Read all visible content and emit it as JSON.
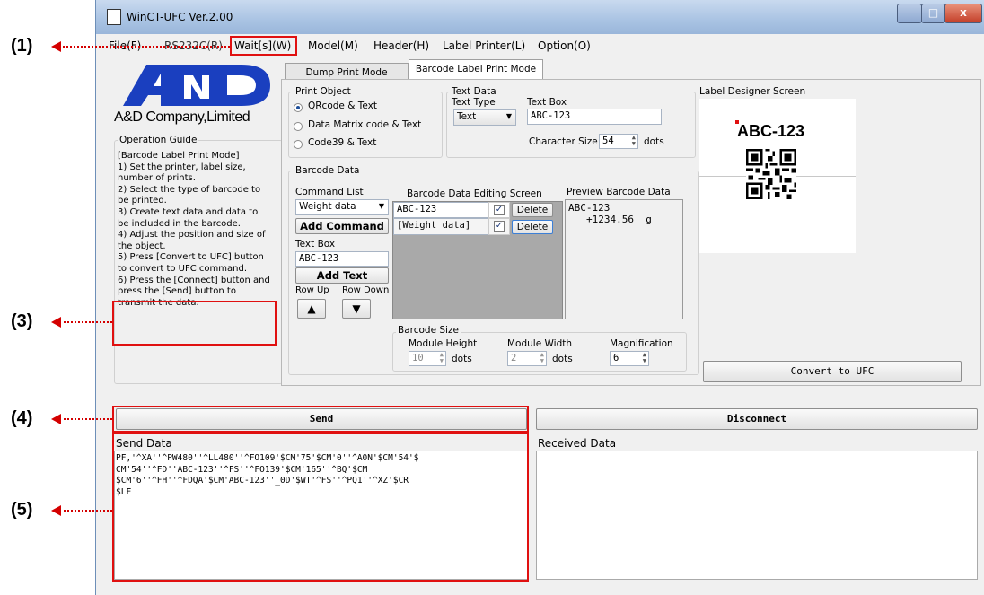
{
  "callouts": {
    "c1": "(1)",
    "c3": "(3)",
    "c4": "(4)",
    "c5": "(5)"
  },
  "window": {
    "title": "WinCT-UFC  Ver.2.00",
    "buttons": {
      "minimize": "–",
      "maximize": "□",
      "close": "x"
    }
  },
  "menu": [
    "File(F)",
    "RS232C(R)",
    "Wait[s](W)",
    "Model(M)",
    "Header(H)",
    "Label Printer(L)",
    "Option(O)"
  ],
  "logo": {
    "brand": "A&D",
    "company": "A&D Company,Limited"
  },
  "guide": {
    "title": "Operation Guide",
    "lines": [
      "[Barcode Label Print Mode]",
      "1) Set the printer, label size,",
      "number of prints.",
      "2) Select the type of barcode to",
      "be printed.",
      "3) Create text data and data to",
      "be included in the barcode.",
      "4) Adjust the position and size of",
      "the object.",
      "5) Press [Convert to UFC] button",
      "to convert to UFC command.",
      "6) Press the [Connect] button and",
      "press the [Send] button to",
      "transmit the data."
    ]
  },
  "tabs": [
    "Dump Print Mode",
    "Barcode Label Print Mode"
  ],
  "print_object": {
    "title": "Print Object",
    "options": [
      "QRcode  &  Text",
      "Data Matrix code  &  Text",
      "Code39  &  Text"
    ],
    "selected": 0
  },
  "text_data": {
    "title": "Text Data",
    "type_label": "Text Type",
    "type_value": "Text",
    "box_label": "Text Box",
    "box_value": "ABC-123",
    "size_label": "Character Size",
    "size_value": "54",
    "size_unit": "dots"
  },
  "barcode_data": {
    "title": "Barcode Data",
    "command_list_label": "Command List",
    "command_value": "Weight data",
    "add_command": "Add Command",
    "text_box_label": "Text Box",
    "text_box_value": "ABC-123",
    "add_text": "Add Text",
    "row_up": "Row Up",
    "row_down": "Row Down",
    "up_arrow": "▲",
    "down_arrow": "▼",
    "editing_label": "Barcode Data Editing Screen",
    "rows": [
      {
        "value": "ABC-123",
        "checked": "✓",
        "delete": "Delete"
      },
      {
        "value": "[Weight data]",
        "checked": "✓",
        "delete": "Delete"
      }
    ],
    "preview_label": "Preview Barcode Data",
    "preview_line1": "ABC-123",
    "preview_line2": "+1234.56  g"
  },
  "barcode_size": {
    "title": "Barcode Size",
    "module_height_label": "Module Height",
    "module_height": "10",
    "module_width_label": "Module Width",
    "module_width": "2",
    "magnification_label": "Magnification",
    "magnification": "6",
    "unit": "dots"
  },
  "label_designer": {
    "title": "Label Designer Screen",
    "text": "ABC-123"
  },
  "convert_button": "Convert to UFC",
  "send_button": "Send",
  "disconnect_button": "Disconnect",
  "send_data": {
    "label": "Send Data",
    "lines": [
      "PF,'^XA''^PW480''^LL480''^FO109'$CM'75'$CM'0''^A0N'$CM'54'$",
      "CM'54''^FD''ABC-123''^FS''^FO139'$CM'165''^BQ'$CM",
      "$CM'6''^FH''^FDQA'$CM'ABC-123''_0D'$WT'^FS''^PQ1''^XZ'$CR",
      "$LF"
    ]
  },
  "received_data": {
    "label": "Received Data"
  },
  "colors": {
    "accent": "#e01010",
    "arrow": "#d40000",
    "logo_blue": "#1a3fbf"
  }
}
